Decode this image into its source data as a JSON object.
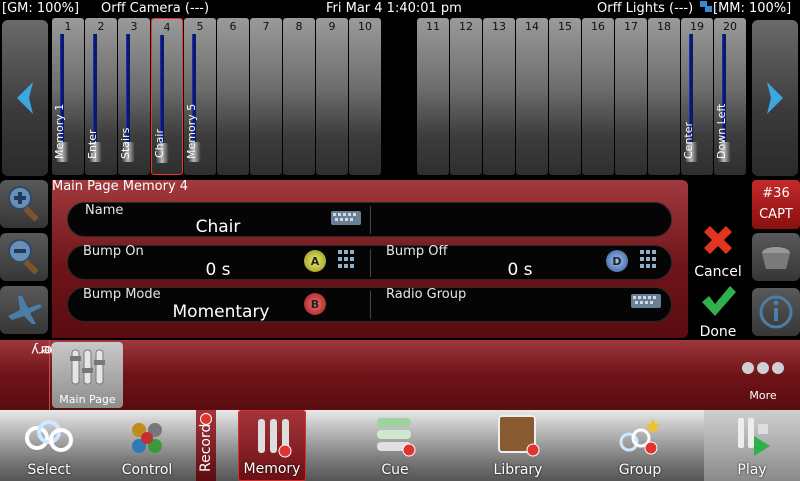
{
  "status": {
    "gm": "[GM: 100%]",
    "camera": "Orff Camera (---)",
    "datetime": "Fri Mar 4 1:40:01 pm",
    "lights": "Orff Lights (---)",
    "mm": "[MM: 100%]"
  },
  "faders_left": [
    {
      "num": "1",
      "label": "Memory 1",
      "level": 1.0
    },
    {
      "num": "2",
      "label": "Enter",
      "level": 1.0
    },
    {
      "num": "3",
      "label": "Stairs",
      "level": 1.0
    },
    {
      "num": "4",
      "label": "Chair",
      "level": 1.0,
      "selected": true
    },
    {
      "num": "5",
      "label": "Memory 5",
      "level": 1.0
    },
    {
      "num": "6",
      "label": ""
    },
    {
      "num": "7",
      "label": ""
    },
    {
      "num": "8",
      "label": ""
    },
    {
      "num": "9",
      "label": ""
    },
    {
      "num": "10",
      "label": ""
    }
  ],
  "faders_right": [
    {
      "num": "11",
      "label": ""
    },
    {
      "num": "12",
      "label": ""
    },
    {
      "num": "13",
      "label": ""
    },
    {
      "num": "14",
      "label": ""
    },
    {
      "num": "15",
      "label": ""
    },
    {
      "num": "16",
      "label": ""
    },
    {
      "num": "17",
      "label": ""
    },
    {
      "num": "18",
      "label": ""
    },
    {
      "num": "19",
      "label": "Center",
      "level": 1.0
    },
    {
      "num": "20",
      "label": "Down Left",
      "level": 1.0
    }
  ],
  "editor": {
    "title": "Main Page Memory 4",
    "name_label": "Name",
    "name_value": "Chair",
    "bump_on_label": "Bump On",
    "bump_on_value": "0 s",
    "bump_on_badge": "A",
    "bump_off_label": "Bump Off",
    "bump_off_value": "0 s",
    "bump_off_badge": "D",
    "bump_mode_label": "Bump Mode",
    "bump_mode_value": "Momentary",
    "bump_mode_badge": "B",
    "radio_group_label": "Radio Group"
  },
  "actions": {
    "cancel": "Cancel",
    "done": "Done"
  },
  "capture": {
    "number": "#36",
    "label": "CAPT"
  },
  "page_bar": {
    "label_line1": "Memory",
    "label_line2": "Page",
    "main_page": "Main Page",
    "more": "More"
  },
  "toolbar": {
    "select": "Select",
    "control": "Control",
    "record": "Record",
    "memory": "Memory",
    "cue": "Cue",
    "library": "Library",
    "group": "Group",
    "play": "Play"
  },
  "colors": {
    "accent_red": "#8a1d22",
    "fader_blue": "#1a2cc0",
    "cancel_red": "#e2341e",
    "done_green": "#2fb04a"
  }
}
